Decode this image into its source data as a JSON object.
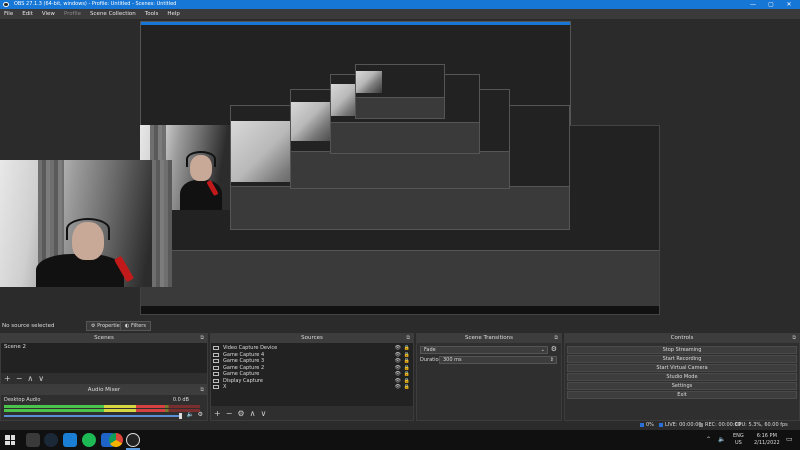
{
  "window": {
    "title": "OBS 27.1.3 (64-bit, windows) - Profile: Untitled - Scenes: Untitled",
    "controls": [
      "—",
      "▢",
      "✕"
    ]
  },
  "menu": [
    "File",
    "Edit",
    "View",
    "Profile",
    "Scene Collection",
    "Tools",
    "Help"
  ],
  "preview_strip": {
    "no_source": "No source selected",
    "properties_btn": "Properties",
    "filters_btn": "Filters"
  },
  "scenes": {
    "title": "Scenes",
    "items": [
      "Scene 2"
    ],
    "footer": [
      "+",
      "−",
      "∧",
      "∨"
    ]
  },
  "sources": {
    "title": "Sources",
    "items": [
      "Video Capture Device",
      "Game Capture 4",
      "Game Capture 3",
      "Game Capture 2",
      "Game Capture",
      "Display Capture",
      "X"
    ],
    "footer": [
      "+",
      "−",
      "⚙",
      "∧",
      "∨"
    ]
  },
  "audio_mixer": {
    "title": "Audio Mixer",
    "channel": "Desktop Audio",
    "db": "0.0 dB",
    "level": 0.82
  },
  "transitions": {
    "title": "Scene Transitions",
    "type": "Fade",
    "duration_label": "Duration",
    "duration_value": "300 ms"
  },
  "controls": {
    "title": "Controls",
    "buttons": [
      "Stop Streaming",
      "Start Recording",
      "Start Virtual Camera",
      "Studio Mode",
      "Settings",
      "Exit"
    ]
  },
  "status": {
    "dropped": "0%",
    "live": "LIVE: 00:00:00",
    "rec": "REC: 00:00:00",
    "cpu": "CPU: 5.3%, 60.00 fps",
    "colors": {
      "drop": "#2a6fd6",
      "live": "#2a6fd6",
      "rec": "#888888"
    }
  },
  "taskbar": {
    "lang_top": "ENG",
    "lang_bottom": "US",
    "time": "6:16 PM",
    "date": "2/11/2022"
  }
}
